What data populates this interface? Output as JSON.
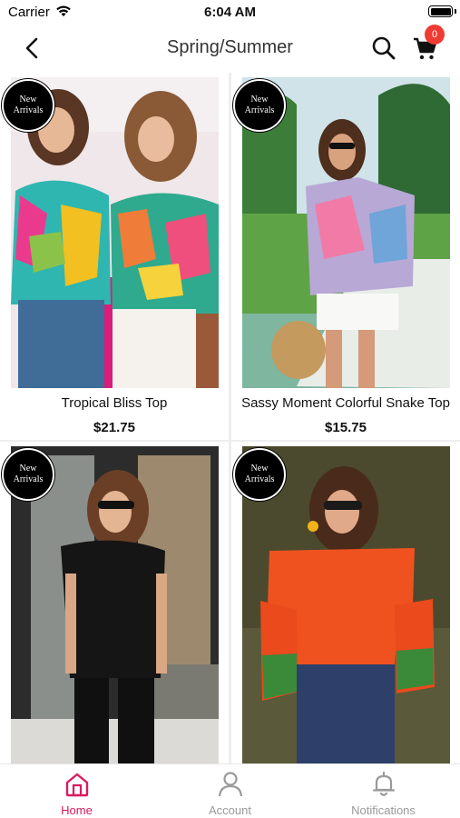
{
  "status_bar": {
    "carrier": "Carrier",
    "time": "6:04 AM",
    "battery_level": 1.0
  },
  "nav": {
    "title": "Spring/Summer",
    "back_icon": "chevron-left-icon",
    "search_icon": "search-icon",
    "cart_icon": "cart-icon",
    "cart_count": "0"
  },
  "products": [
    {
      "name": "Tropical Bliss Top",
      "price": "$21.75",
      "badge_line1": "New",
      "badge_line2": "Arrivals"
    },
    {
      "name": "Sassy Moment Colorful Snake Top",
      "price": "$15.75",
      "badge_line1": "New",
      "badge_line2": "Arrivals"
    },
    {
      "name": "",
      "price": "",
      "badge_line1": "New",
      "badge_line2": "Arrivals"
    },
    {
      "name": "",
      "price": "",
      "badge_line1": "New",
      "badge_line2": "Arrivals"
    }
  ],
  "tabs": [
    {
      "label": "Home",
      "icon": "home-icon",
      "active": true
    },
    {
      "label": "Account",
      "icon": "account-icon",
      "active": false
    },
    {
      "label": "Notifications",
      "icon": "bell-icon",
      "active": false
    }
  ],
  "colors": {
    "accent": "#d81b60",
    "inactive": "#9a9a9a",
    "badge": "#ef3b33"
  }
}
